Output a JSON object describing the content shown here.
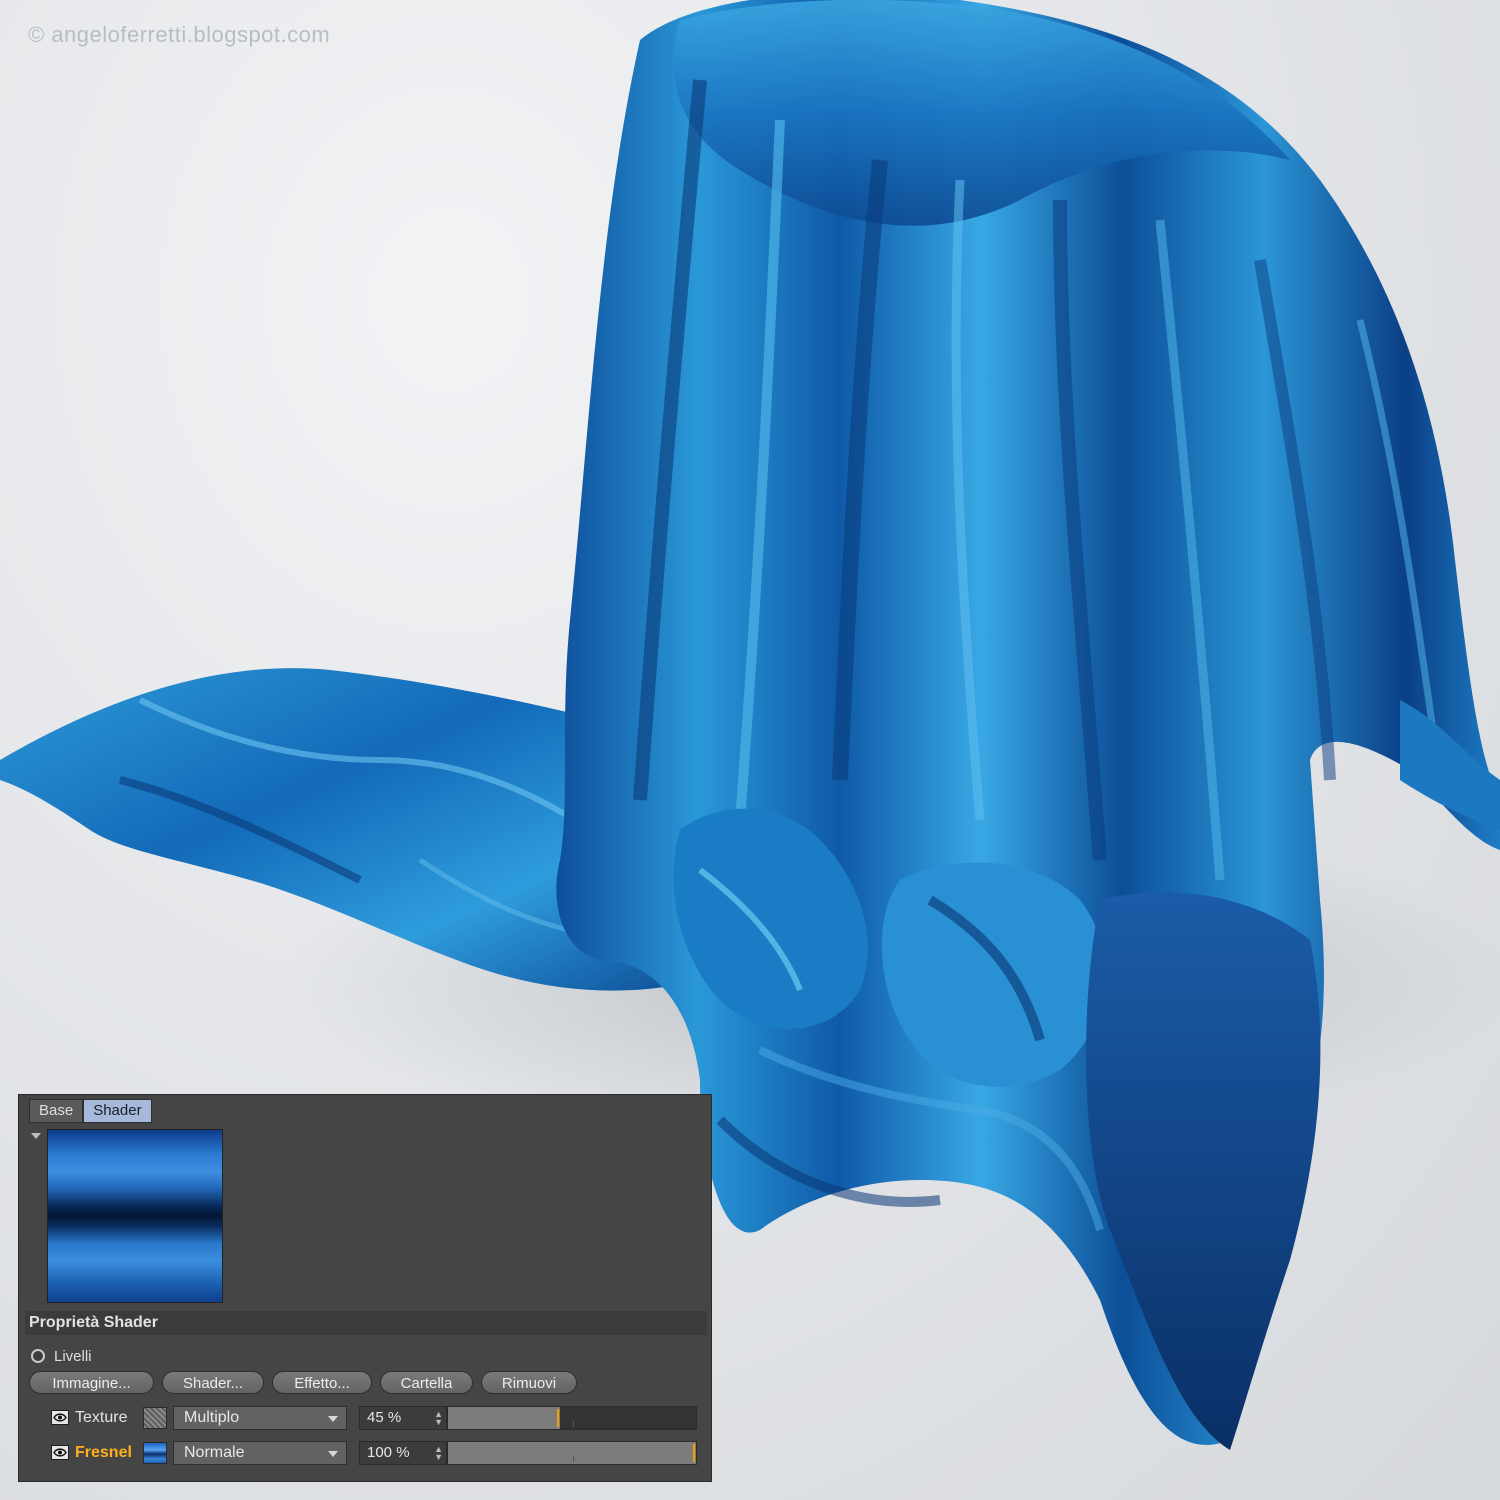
{
  "watermark": "© angeloferretti.blogspot.com",
  "panel": {
    "tabs": [
      {
        "label": "Base",
        "active": false
      },
      {
        "label": "Shader",
        "active": true
      }
    ],
    "section_title": "Proprietà Shader",
    "radio_label": "Livelli",
    "buttons": [
      "Immagine...",
      "Shader...",
      "Effetto...",
      "Cartella",
      "Rimuovi"
    ],
    "layers": [
      {
        "name": "Texture",
        "mode": "Multiplo",
        "value_text": "45 %",
        "value": 0.45,
        "highlighted": false,
        "thumb_icon": "noise-texture-icon"
      },
      {
        "name": "Fresnel",
        "mode": "Normale",
        "value_text": "100 %",
        "value": 1.0,
        "highlighted": true,
        "thumb_icon": "fresnel-gradient-icon"
      }
    ],
    "colors": {
      "panel_bg": "#454545",
      "active_tab": "#a6b9da",
      "highlight_text": "#ffb020",
      "slider_marker": "#f2a000",
      "fabric": "#1f7fc4"
    }
  }
}
